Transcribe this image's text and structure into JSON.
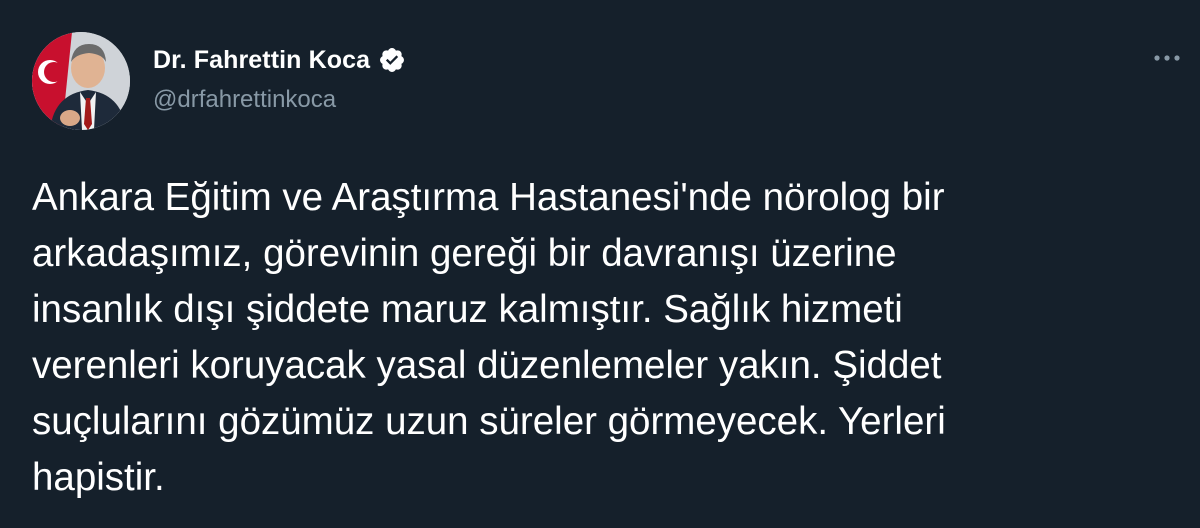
{
  "tweet": {
    "author": {
      "display_name": "Dr. Fahrettin Koca",
      "handle": "@drfahrettinkoca",
      "verified": true,
      "avatar_icon": "avatar-photo"
    },
    "menu_icon": "more-horizontal-icon",
    "text": "Ankara Eğitim ve Araştırma Hastanesi'nde nörolog bir\narkadaşımız, görevinin gereği bir davranışı üzerine\ninsanlık dışı şiddete maruz kalmıştır. Sağlık hizmeti\nverenleri koruyacak yasal düzenlemeler yakın. Şiddet\nsuçlularını gözümüz uzun süreler görmeyecek. Yerleri\nhapistir."
  },
  "colors": {
    "background": "#15202b",
    "primary_text": "#ffffff",
    "secondary_text": "#8899a6"
  }
}
